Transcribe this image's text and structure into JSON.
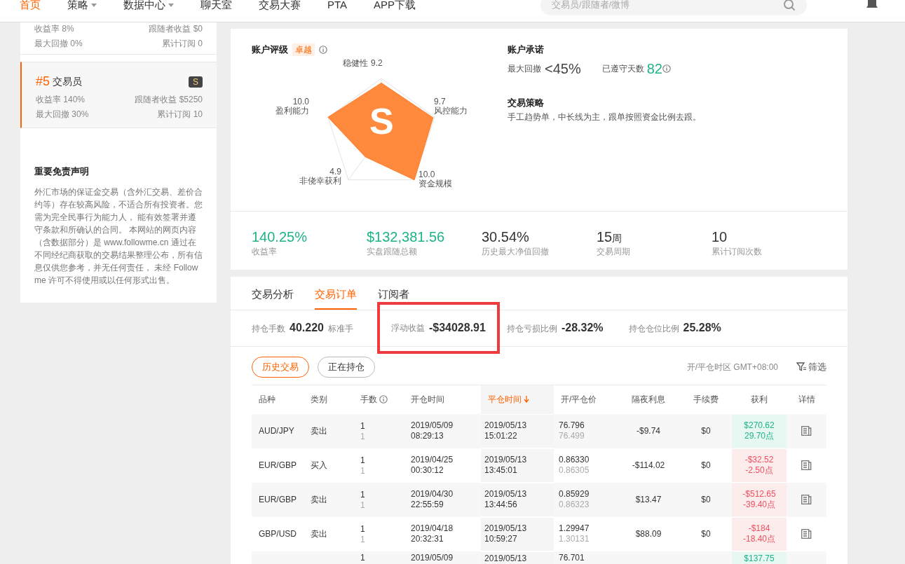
{
  "nav": {
    "items": [
      {
        "label": "首页",
        "selected": true,
        "dropdown": false
      },
      {
        "label": "策略",
        "selected": false,
        "dropdown": true
      },
      {
        "label": "数据中心",
        "selected": false,
        "dropdown": true
      },
      {
        "label": "聊天室",
        "selected": false,
        "dropdown": false
      },
      {
        "label": "交易大赛",
        "selected": false,
        "dropdown": false
      },
      {
        "label": "PTA",
        "selected": false,
        "dropdown": false
      },
      {
        "label": "APP下载",
        "selected": false,
        "dropdown": false
      }
    ],
    "search": {
      "placeholder": "交易员/跟随者/微博"
    }
  },
  "sidebar": {
    "traders": [
      {
        "selected": false,
        "return": "收益率 8%",
        "follower_profit": "跟随者收益 $0",
        "drawdown": "最大回撤 0%",
        "subscriptions": "累计订阅 0"
      },
      {
        "rank": "#5",
        "name": "交易员",
        "badge": "S",
        "selected": true,
        "return": "收益率 140%",
        "follower_profit": "跟随者收益 $5250",
        "drawdown": "最大回撤 30%",
        "subscriptions": "累计订阅 10"
      }
    ],
    "disclaimer": {
      "title": "重要免责声明",
      "text": "外汇市场的保证金交易（含外汇交易、差价合约等）存在较高风险，不适合所有投资者。您需为完全民事行为能力人， 能有效签署并遵守条款和所确认的合同。 本网站的网页内容（含数据部分）是 www.followme.cn 通过在不同经纪商获取的交易结果整理公布，所有信息仅供您参考，并无任何责任， 未经 Followme 许可不得使用或以任何形式出售。"
    }
  },
  "rating": {
    "title": "账户评级",
    "badge": "卓越",
    "grade": "S",
    "axes": [
      {
        "label": "稳健性",
        "value": "9.2"
      },
      {
        "label": "盈利能力",
        "value": "10.0"
      },
      {
        "label": "风控能力",
        "value": "9.7"
      },
      {
        "label": "非侥幸获利",
        "value": "4.9"
      },
      {
        "label": "资金规模",
        "value": "10.0"
      }
    ]
  },
  "commitment": {
    "title": "账户承诺",
    "max_drawdown_label": "最大回撤",
    "max_drawdown": "<45%",
    "days_label": "已遵守天数",
    "days": "82"
  },
  "strategy": {
    "title": "交易策略",
    "text": "手工趋势单，中长线为主，跟单按照资金比例去跟。"
  },
  "summary": [
    {
      "value": "140.25%",
      "label": "收益率",
      "accent": true
    },
    {
      "value": "$132,381.56",
      "label": "实盘跟随总额",
      "accent": true
    },
    {
      "value": "30.54%",
      "label": "历史最大净值回撤",
      "accent": false
    },
    {
      "value": "15",
      "unit": "周",
      "label": "交易周期",
      "accent": false
    },
    {
      "value": "10",
      "label": "累计订阅次数",
      "accent": false
    }
  ],
  "tabs": [
    {
      "label": "交易分析",
      "selected": false
    },
    {
      "label": "交易订单",
      "selected": true
    },
    {
      "label": "订阅者",
      "selected": false
    }
  ],
  "position_stats": [
    {
      "label": "持仓手数",
      "value": "40.220",
      "unit": "标准手",
      "highlighted": false
    },
    {
      "label": "浮动收益",
      "value": "-$34028.91",
      "highlighted": true
    },
    {
      "label": "持仓亏损比例",
      "value": "-28.32%",
      "highlighted": false
    },
    {
      "label": "持仓仓位比例",
      "value": "25.28%",
      "highlighted": false
    }
  ],
  "filters": [
    {
      "label": "历史交易",
      "selected": true
    },
    {
      "label": "正在持仓",
      "selected": false
    }
  ],
  "timezone": "开/平仓时区 GMT+08:00",
  "filter_button": "筛选",
  "table": {
    "columns": [
      {
        "label": "品种",
        "sorted": false,
        "info": false
      },
      {
        "label": "类别",
        "sorted": false,
        "info": false
      },
      {
        "label": "手数",
        "sorted": false,
        "info": true
      },
      {
        "label": "开仓时间",
        "sorted": false,
        "info": false
      },
      {
        "label": "平仓时间",
        "sorted": true,
        "info": false
      },
      {
        "label": "开/平仓价",
        "sorted": false,
        "info": false
      },
      {
        "label": "隔夜利息",
        "sorted": false,
        "info": false
      },
      {
        "label": "手续费",
        "sorted": false,
        "info": false
      },
      {
        "label": "获利",
        "sorted": false,
        "info": false
      },
      {
        "label": "详情",
        "sorted": false,
        "info": false
      }
    ],
    "rows": [
      {
        "symbol": "AUD/JPY",
        "side": "卖出",
        "lots": [
          "1",
          "1"
        ],
        "open_time": [
          "2019/05/09",
          "08:29:13"
        ],
        "close_time": [
          "2019/05/13",
          "15:01:22"
        ],
        "prices": [
          "76.796",
          "76.499"
        ],
        "swap": "-$9.74",
        "fee": "$0",
        "profit": [
          "$270.62",
          "29.70点"
        ],
        "positive": true
      },
      {
        "symbol": "EUR/GBP",
        "side": "买入",
        "lots": [
          "1",
          "1"
        ],
        "open_time": [
          "2019/04/25",
          "00:30:12"
        ],
        "close_time": [
          "2019/05/13",
          "13:45:01"
        ],
        "prices": [
          "0.86330",
          "0.86305"
        ],
        "swap": "-$114.02",
        "fee": "$0",
        "profit": [
          "-$32.52",
          "-2.50点"
        ],
        "positive": false
      },
      {
        "symbol": "EUR/GBP",
        "side": "卖出",
        "lots": [
          "1",
          "1"
        ],
        "open_time": [
          "2019/04/30",
          "22:55:59"
        ],
        "close_time": [
          "2019/05/13",
          "13:44:56"
        ],
        "prices": [
          "0.85929",
          "0.86323"
        ],
        "swap": "$13.47",
        "fee": "$0",
        "profit": [
          "-$512.65",
          "-39.40点"
        ],
        "positive": false
      },
      {
        "symbol": "GBP/USD",
        "side": "卖出",
        "lots": [
          "1",
          "1"
        ],
        "open_time": [
          "2019/04/18",
          "20:32:31"
        ],
        "close_time": [
          "2019/05/13",
          "10:59:27"
        ],
        "prices": [
          "1.29947",
          "1.30131"
        ],
        "swap": "$88.09",
        "fee": "$0",
        "profit": [
          "-$184",
          "-18.40点"
        ],
        "positive": false
      },
      {
        "lots": [
          "1"
        ],
        "open_time": [
          "2019/05/09"
        ],
        "close_time": [
          "2019/05/13"
        ],
        "prices": [
          "76.701"
        ],
        "profit": [
          "$137.75"
        ],
        "positive": true
      }
    ]
  }
}
